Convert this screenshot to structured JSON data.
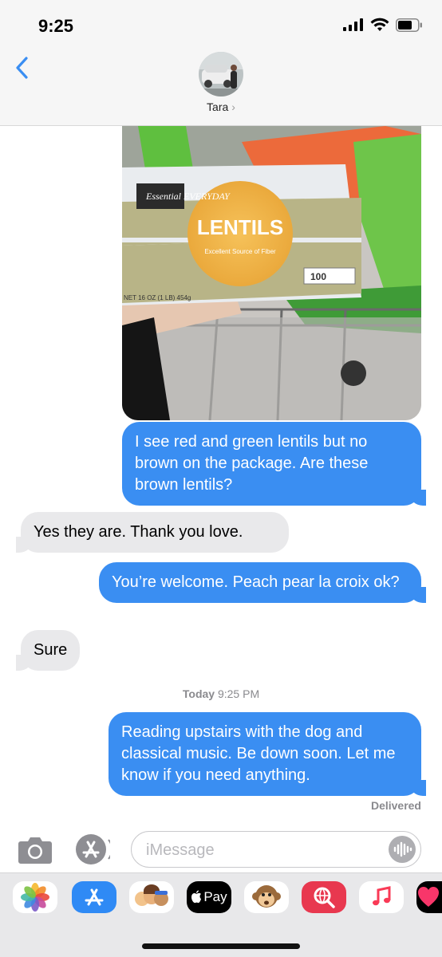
{
  "status_bar": {
    "time": "9:25",
    "icons": [
      "cellular-signal-icon",
      "wifi-icon",
      "battery-icon"
    ]
  },
  "header": {
    "contact_name": "Tara",
    "chevron": "›",
    "back_icon": "chevron-left-icon",
    "accent_color": "#3a8ef2"
  },
  "photo": {
    "package_brand": "Essential EVERYDAY",
    "package_title": "LENTILS",
    "package_claim": "Excellent Source of Fiber",
    "package_weight": "NET 16 OZ (1 LB) 454g",
    "calories": "100"
  },
  "messages": [
    {
      "direction": "out",
      "text": "I see red and green lentils but no brown on the package. Are these brown lentils?"
    },
    {
      "direction": "in",
      "text": "Yes they are. Thank you love."
    },
    {
      "direction": "out",
      "text": "You’re welcome. Peach pear la croix ok?"
    },
    {
      "direction": "in",
      "text": "Sure"
    },
    {
      "direction": "out",
      "text": "Reading upstairs with the dog and classical music. Be down soon. Let me know if you need anything."
    }
  ],
  "timestamp": {
    "day": "Today",
    "time": "9:25 PM"
  },
  "delivery_status": "Delivered",
  "composer": {
    "placeholder": "iMessage",
    "value": ""
  },
  "app_drawer": {
    "apps": [
      {
        "name": "photos-icon"
      },
      {
        "name": "app-store-icon"
      },
      {
        "name": "memoji-icon"
      },
      {
        "name": "apple-pay-icon",
        "label": "Pay"
      },
      {
        "name": "animoji-monkey-icon"
      },
      {
        "name": "web-search-icon"
      },
      {
        "name": "music-icon"
      },
      {
        "name": "digital-touch-icon"
      }
    ]
  },
  "colors": {
    "outgoing_bubble": "#3a8ef2",
    "incoming_bubble": "#e9e9eb",
    "header_background": "#f6f6f6"
  }
}
